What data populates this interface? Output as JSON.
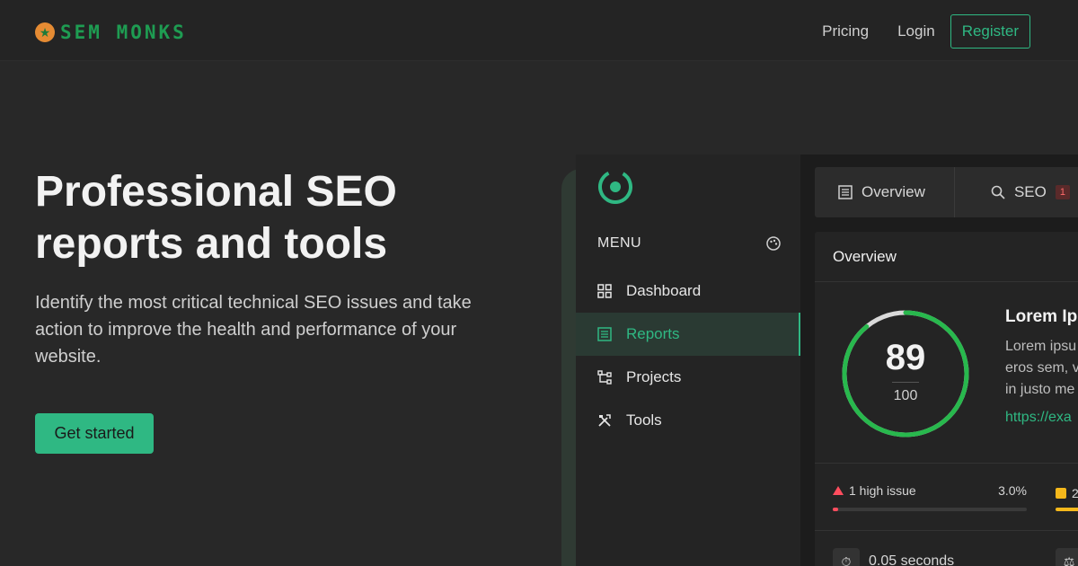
{
  "brand": {
    "name": "SEM MONKS",
    "logo_icon": "star-badge-icon"
  },
  "nav": {
    "pricing": "Pricing",
    "login": "Login",
    "register": "Register"
  },
  "hero": {
    "title_line1": "Professional SEO",
    "title_line2": "reports and tools",
    "subtitle": "Identify the most critical technical SEO issues and take action to improve the health and performance of your website.",
    "cta": "Get started"
  },
  "app": {
    "menu_label": "MENU",
    "menu_items": [
      {
        "label": "Dashboard",
        "icon": "grid-icon",
        "active": false
      },
      {
        "label": "Reports",
        "icon": "report-list-icon",
        "active": true
      },
      {
        "label": "Projects",
        "icon": "projects-icon",
        "active": false
      },
      {
        "label": "Tools",
        "icon": "tools-icon",
        "active": false
      }
    ],
    "tabs": [
      {
        "label": "Overview",
        "icon": "report-list-icon"
      },
      {
        "label": "SEO",
        "icon": "search-icon",
        "badge": "1"
      }
    ],
    "panel_title": "Overview",
    "score": {
      "value": "89",
      "max": "100",
      "fraction": 0.89,
      "color": "#28b84d"
    },
    "card": {
      "title": "Lorem Ip",
      "lines": [
        "Lorem ipsu",
        "eros sem, v",
        "in justo me"
      ],
      "link": "https://exa"
    },
    "issues": {
      "high_label": "1 high issue",
      "high_pct": "3.0%",
      "high_fraction": 0.03,
      "medium_label": "2"
    },
    "load_time": "0.05 seconds"
  },
  "colors": {
    "accent": "#2fb883",
    "brand_green": "#1e9c52",
    "danger": "#ff4d5e",
    "warning": "#f5b81b"
  }
}
